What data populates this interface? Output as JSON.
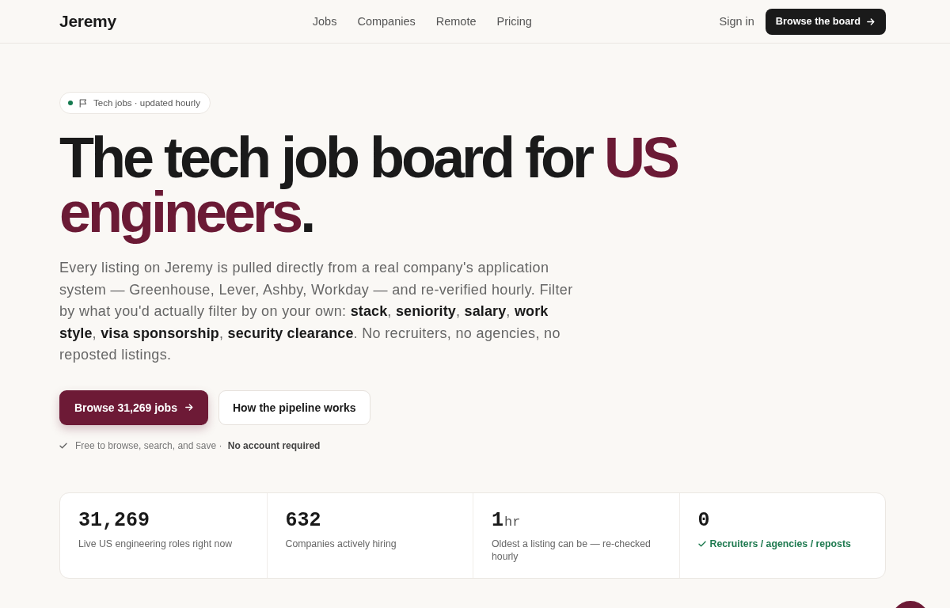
{
  "header": {
    "logo": "Jeremy",
    "nav": [
      "Jobs",
      "Companies",
      "Remote",
      "Pricing"
    ],
    "sign_in": "Sign in",
    "cta": "Browse the board"
  },
  "hero": {
    "badge": "Tech jobs · updated hourly",
    "headline": [
      {
        "text": "The tech job board for ",
        "highlight": false
      },
      {
        "text": "US engineers",
        "highlight": true
      },
      {
        "text": ".",
        "highlight": false
      }
    ],
    "description": "Every listing on Jeremy is pulled directly from a real company's application system — Greenhouse, Lever, Ashby, Workday — and re-verified hourly. Filter by what you'd actually filter by on your own: **stack**, **seniority**, **salary**, **work style**, **visa sponsorship**, **security clearance**. No recruiters, no agencies, no reposted listings.",
    "buttons": [
      {
        "label": "Browse 31,269 jobs",
        "kind": "primary"
      },
      {
        "label": "How the pipeline works",
        "kind": "secondary"
      }
    ],
    "note": "Free to browse, search, and save · **No account required**"
  },
  "stats": [
    {
      "value": "31,269",
      "label": "Live US engineering roles right now",
      "kind": "plain"
    },
    {
      "value": "632",
      "label": "Companies actively hiring",
      "kind": "plain"
    },
    {
      "value": "1",
      "unit": "hr",
      "label": "Oldest a listing can be — re-checked hourly",
      "kind": "plain"
    },
    {
      "value": "0",
      "label": "Recruiters / agencies / reposts",
      "kind": "verified"
    }
  ]
}
